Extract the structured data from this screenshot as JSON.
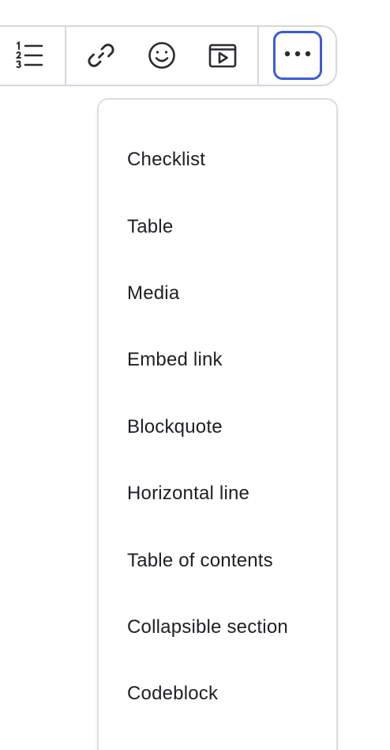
{
  "toolbar": {
    "buttons": [
      {
        "icon": "numbered-list-icon"
      },
      {
        "icon": "link-icon"
      },
      {
        "icon": "emoji-icon"
      },
      {
        "icon": "video-embed-icon"
      },
      {
        "icon": "more-options-icon",
        "active": true
      }
    ],
    "accent_color": "#3b5bdb",
    "border_color": "#d7d7dd",
    "icon_color": "#2a2a30"
  },
  "insert_menu": {
    "items": [
      {
        "label": "Checklist"
      },
      {
        "label": "Table"
      },
      {
        "label": "Media"
      },
      {
        "label": "Embed link"
      },
      {
        "label": "Blockquote"
      },
      {
        "label": "Horizontal line"
      },
      {
        "label": "Table of contents"
      },
      {
        "label": "Collapsible section"
      },
      {
        "label": "Codeblock"
      }
    ]
  }
}
